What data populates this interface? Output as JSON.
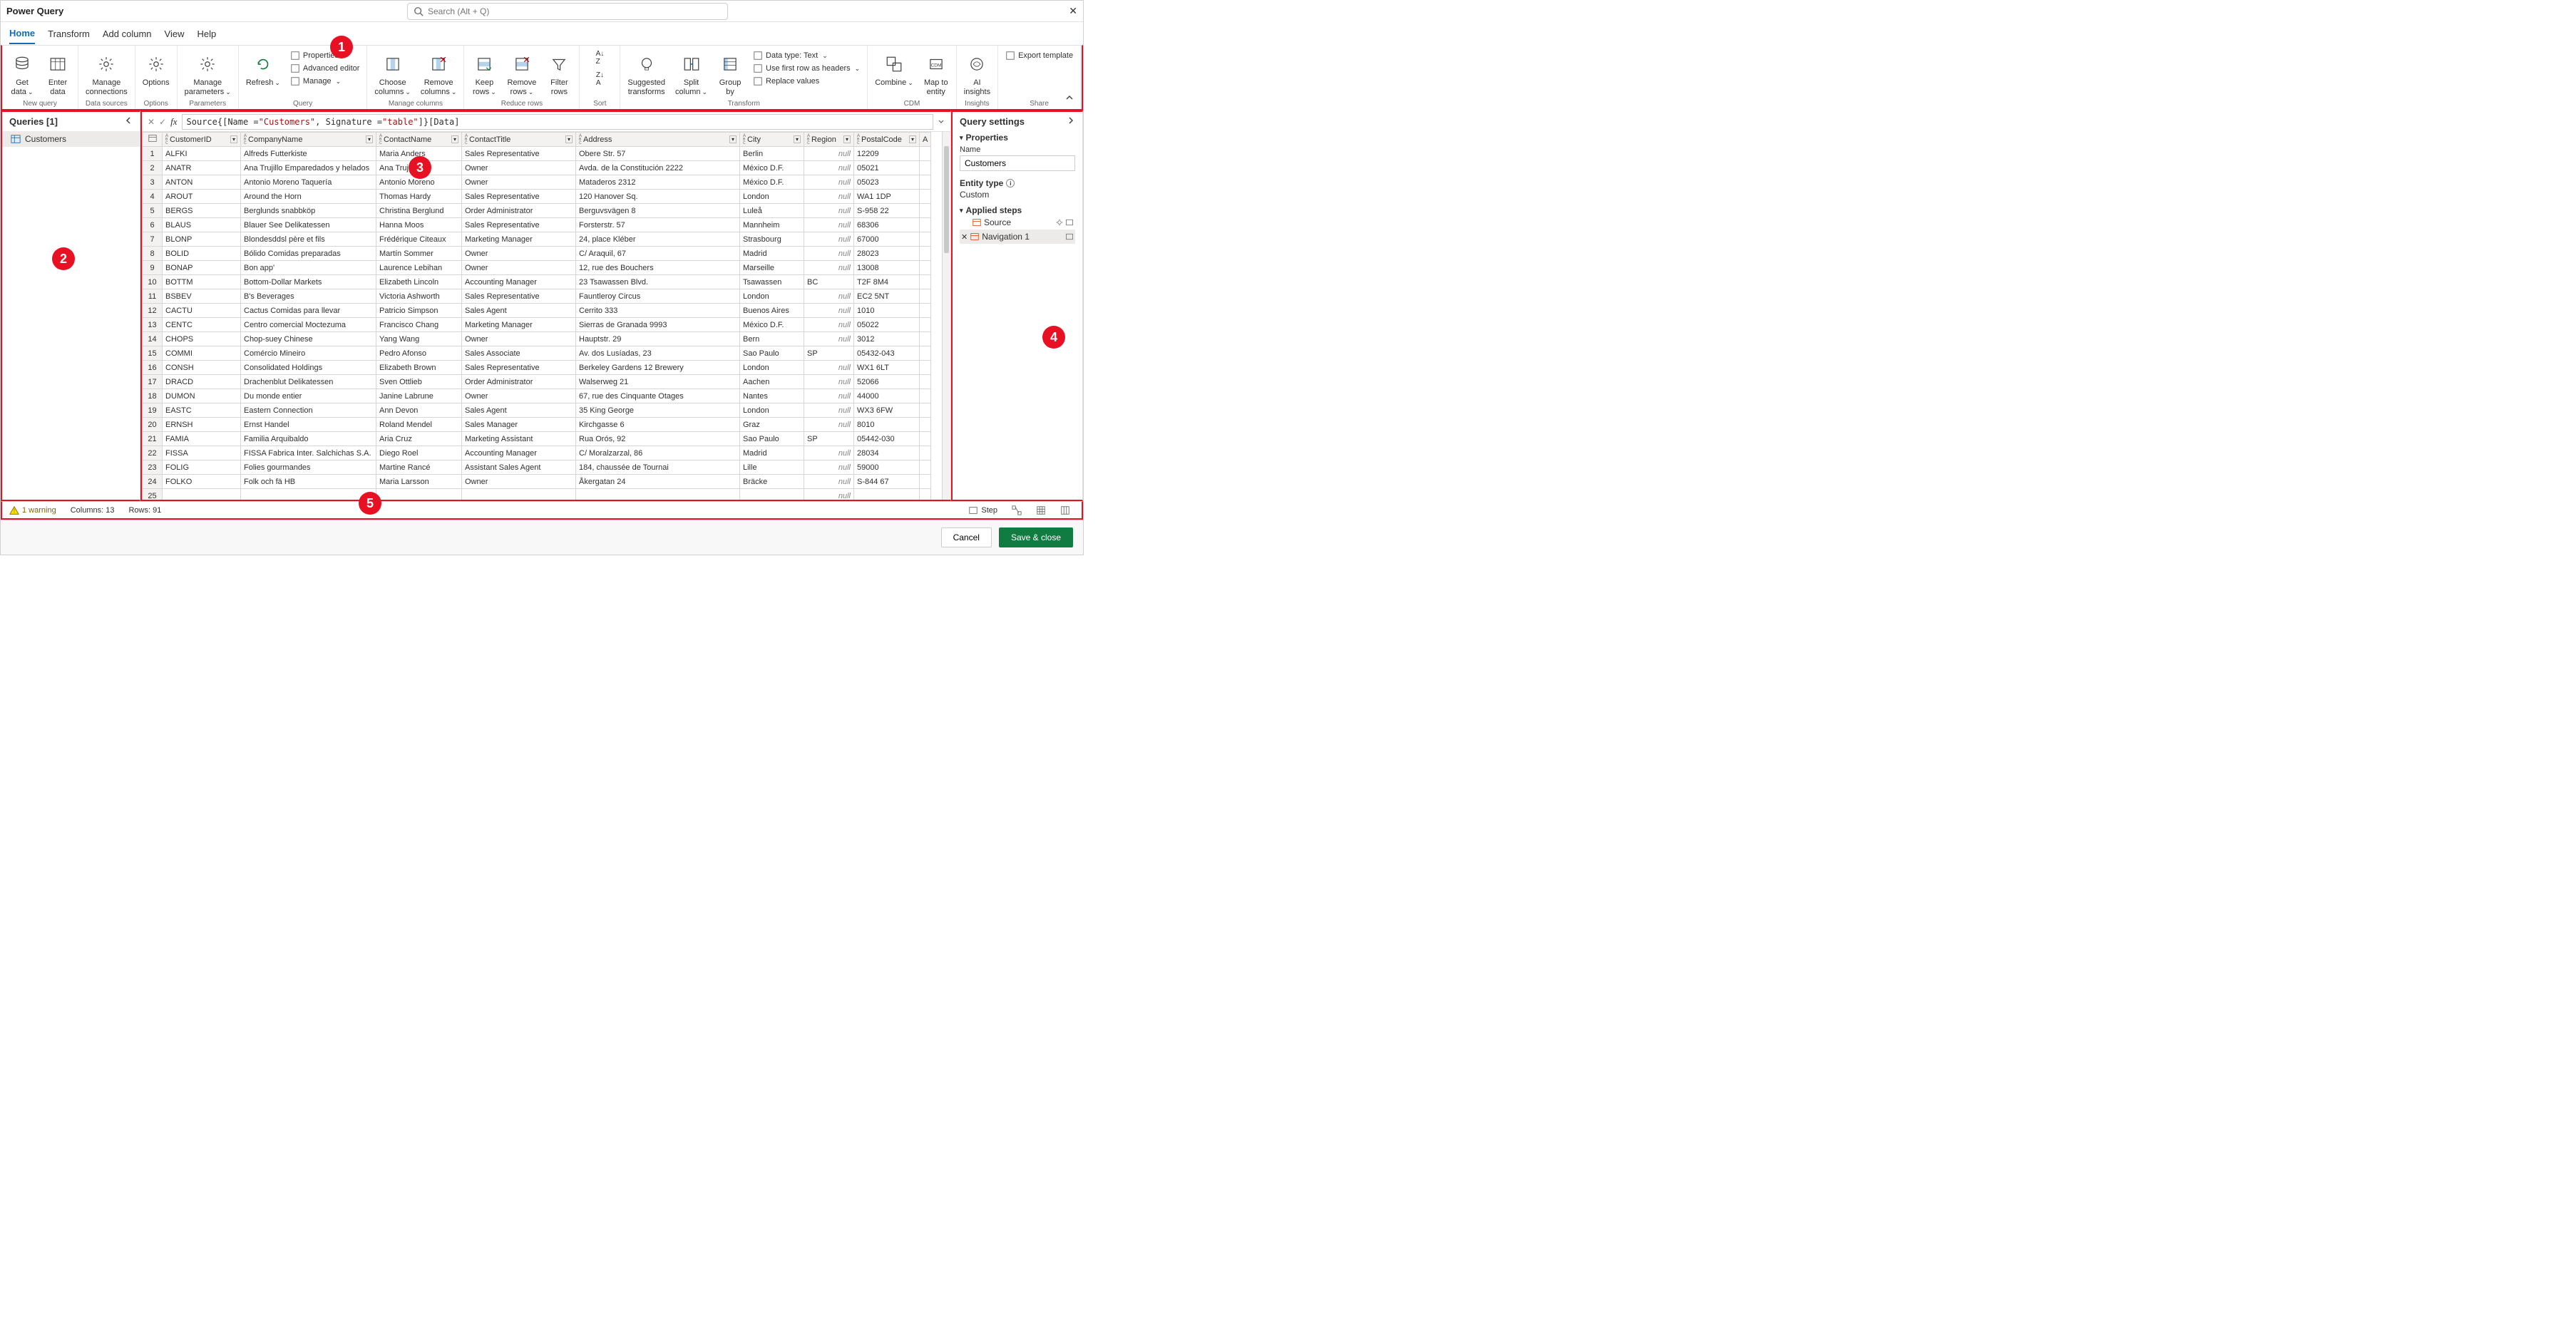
{
  "app_title": "Power Query",
  "search_placeholder": "Search (Alt + Q)",
  "tabs": [
    "Home",
    "Transform",
    "Add column",
    "View",
    "Help"
  ],
  "ribbon": {
    "groups": [
      {
        "label": "New query",
        "buttons": [
          {
            "t": "Get\ndata"
          },
          {
            "t": "Enter\ndata"
          }
        ]
      },
      {
        "label": "Data sources",
        "buttons": [
          {
            "t": "Manage\nconnections"
          }
        ]
      },
      {
        "label": "Options",
        "buttons": [
          {
            "t": "Options"
          }
        ]
      },
      {
        "label": "Parameters",
        "buttons": [
          {
            "t": "Manage\nparameters"
          }
        ]
      },
      {
        "label": "Query",
        "buttons": [
          {
            "t": "Refresh"
          }
        ],
        "lines": [
          "Properties",
          "Advanced editor",
          "Manage"
        ]
      },
      {
        "label": "Manage columns",
        "buttons": [
          {
            "t": "Choose\ncolumns"
          },
          {
            "t": "Remove\ncolumns"
          }
        ]
      },
      {
        "label": "Reduce rows",
        "buttons": [
          {
            "t": "Keep\nrows"
          },
          {
            "t": "Remove\nrows"
          },
          {
            "t": "Filter\nrows"
          }
        ]
      },
      {
        "label": "Sort"
      },
      {
        "label": "Transform",
        "buttons": [
          {
            "t": "Suggested\ntransforms"
          },
          {
            "t": "Split\ncolumn"
          },
          {
            "t": "Group\nby"
          }
        ],
        "lines": [
          "Data type: Text",
          "Use first row as headers",
          "Replace values"
        ]
      },
      {
        "label": "CDM",
        "buttons": [
          {
            "t": "Combine"
          },
          {
            "t": "Map to\nentity"
          }
        ]
      },
      {
        "label": "Insights",
        "buttons": [
          {
            "t": "AI\ninsights"
          }
        ]
      },
      {
        "label": "Share",
        "lines": [
          "Export template"
        ]
      }
    ]
  },
  "queries_header": "Queries [1]",
  "queries": [
    "Customers"
  ],
  "formula": {
    "pre": "Source{[Name = ",
    "q1": "\"Customers\"",
    "mid": ", Signature = ",
    "q2": "\"table\"",
    "post": "]}[Data]"
  },
  "columns": [
    "CustomerID",
    "CompanyName",
    "ContactName",
    "ContactTitle",
    "Address",
    "City",
    "Region",
    "PostalCode"
  ],
  "rows": [
    {
      "n": 1,
      "CustomerID": "ALFKI",
      "CompanyName": "Alfreds Futterkiste",
      "ContactName": "Maria Anders",
      "ContactTitle": "Sales Representative",
      "Address": "Obere Str. 57",
      "City": "Berlin",
      "Region": null,
      "PostalCode": "12209"
    },
    {
      "n": 2,
      "CustomerID": "ANATR",
      "CompanyName": "Ana Trujillo Emparedados y helados",
      "ContactName": "Ana Trujillo",
      "ContactTitle": "Owner",
      "Address": "Avda. de la Constitución 2222",
      "City": "México D.F.",
      "Region": null,
      "PostalCode": "05021"
    },
    {
      "n": 3,
      "CustomerID": "ANTON",
      "CompanyName": "Antonio Moreno Taquería",
      "ContactName": "Antonio Moreno",
      "ContactTitle": "Owner",
      "Address": "Mataderos  2312",
      "City": "México D.F.",
      "Region": null,
      "PostalCode": "05023"
    },
    {
      "n": 4,
      "CustomerID": "AROUT",
      "CompanyName": "Around the Horn",
      "ContactName": "Thomas Hardy",
      "ContactTitle": "Sales Representative",
      "Address": "120 Hanover Sq.",
      "City": "London",
      "Region": null,
      "PostalCode": "WA1 1DP"
    },
    {
      "n": 5,
      "CustomerID": "BERGS",
      "CompanyName": "Berglunds snabbköp",
      "ContactName": "Christina Berglund",
      "ContactTitle": "Order Administrator",
      "Address": "Berguvsvägen  8",
      "City": "Luleå",
      "Region": null,
      "PostalCode": "S-958 22"
    },
    {
      "n": 6,
      "CustomerID": "BLAUS",
      "CompanyName": "Blauer See Delikatessen",
      "ContactName": "Hanna Moos",
      "ContactTitle": "Sales Representative",
      "Address": "Forsterstr. 57",
      "City": "Mannheim",
      "Region": null,
      "PostalCode": "68306"
    },
    {
      "n": 7,
      "CustomerID": "BLONP",
      "CompanyName": "Blondesddsl père et fils",
      "ContactName": "Frédérique Citeaux",
      "ContactTitle": "Marketing Manager",
      "Address": "24, place Kléber",
      "City": "Strasbourg",
      "Region": null,
      "PostalCode": "67000"
    },
    {
      "n": 8,
      "CustomerID": "BOLID",
      "CompanyName": "Bólido Comidas preparadas",
      "ContactName": "Martín Sommer",
      "ContactTitle": "Owner",
      "Address": "C/ Araquil, 67",
      "City": "Madrid",
      "Region": null,
      "PostalCode": "28023"
    },
    {
      "n": 9,
      "CustomerID": "BONAP",
      "CompanyName": "Bon app'",
      "ContactName": "Laurence Lebihan",
      "ContactTitle": "Owner",
      "Address": "12, rue des Bouchers",
      "City": "Marseille",
      "Region": null,
      "PostalCode": "13008"
    },
    {
      "n": 10,
      "CustomerID": "BOTTM",
      "CompanyName": "Bottom-Dollar Markets",
      "ContactName": "Elizabeth Lincoln",
      "ContactTitle": "Accounting Manager",
      "Address": "23 Tsawassen Blvd.",
      "City": "Tsawassen",
      "Region": "BC",
      "PostalCode": "T2F 8M4"
    },
    {
      "n": 11,
      "CustomerID": "BSBEV",
      "CompanyName": "B's Beverages",
      "ContactName": "Victoria Ashworth",
      "ContactTitle": "Sales Representative",
      "Address": "Fauntleroy Circus",
      "City": "London",
      "Region": null,
      "PostalCode": "EC2 5NT"
    },
    {
      "n": 12,
      "CustomerID": "CACTU",
      "CompanyName": "Cactus Comidas para llevar",
      "ContactName": "Patricio Simpson",
      "ContactTitle": "Sales Agent",
      "Address": "Cerrito 333",
      "City": "Buenos Aires",
      "Region": null,
      "PostalCode": "1010"
    },
    {
      "n": 13,
      "CustomerID": "CENTC",
      "CompanyName": "Centro comercial Moctezuma",
      "ContactName": "Francisco Chang",
      "ContactTitle": "Marketing Manager",
      "Address": "Sierras de Granada 9993",
      "City": "México D.F.",
      "Region": null,
      "PostalCode": "05022"
    },
    {
      "n": 14,
      "CustomerID": "CHOPS",
      "CompanyName": "Chop-suey Chinese",
      "ContactName": "Yang Wang",
      "ContactTitle": "Owner",
      "Address": "Hauptstr. 29",
      "City": "Bern",
      "Region": null,
      "PostalCode": "3012"
    },
    {
      "n": 15,
      "CustomerID": "COMMI",
      "CompanyName": "Comércio Mineiro",
      "ContactName": "Pedro Afonso",
      "ContactTitle": "Sales Associate",
      "Address": "Av. dos Lusíadas, 23",
      "City": "Sao Paulo",
      "Region": "SP",
      "PostalCode": "05432-043"
    },
    {
      "n": 16,
      "CustomerID": "CONSH",
      "CompanyName": "Consolidated Holdings",
      "ContactName": "Elizabeth Brown",
      "ContactTitle": "Sales Representative",
      "Address": "Berkeley Gardens 12  Brewery",
      "City": "London",
      "Region": null,
      "PostalCode": "WX1 6LT"
    },
    {
      "n": 17,
      "CustomerID": "DRACD",
      "CompanyName": "Drachenblut Delikatessen",
      "ContactName": "Sven Ottlieb",
      "ContactTitle": "Order Administrator",
      "Address": "Walserweg 21",
      "City": "Aachen",
      "Region": null,
      "PostalCode": "52066"
    },
    {
      "n": 18,
      "CustomerID": "DUMON",
      "CompanyName": "Du monde entier",
      "ContactName": "Janine Labrune",
      "ContactTitle": "Owner",
      "Address": "67, rue des Cinquante Otages",
      "City": "Nantes",
      "Region": null,
      "PostalCode": "44000"
    },
    {
      "n": 19,
      "CustomerID": "EASTC",
      "CompanyName": "Eastern Connection",
      "ContactName": "Ann Devon",
      "ContactTitle": "Sales Agent",
      "Address": "35 King George",
      "City": "London",
      "Region": null,
      "PostalCode": "WX3 6FW"
    },
    {
      "n": 20,
      "CustomerID": "ERNSH",
      "CompanyName": "Ernst Handel",
      "ContactName": "Roland Mendel",
      "ContactTitle": "Sales Manager",
      "Address": "Kirchgasse 6",
      "City": "Graz",
      "Region": null,
      "PostalCode": "8010"
    },
    {
      "n": 21,
      "CustomerID": "FAMIA",
      "CompanyName": "Familia Arquibaldo",
      "ContactName": "Aria Cruz",
      "ContactTitle": "Marketing Assistant",
      "Address": "Rua Orós, 92",
      "City": "Sao Paulo",
      "Region": "SP",
      "PostalCode": "05442-030"
    },
    {
      "n": 22,
      "CustomerID": "FISSA",
      "CompanyName": "FISSA Fabrica Inter. Salchichas S.A.",
      "ContactName": "Diego Roel",
      "ContactTitle": "Accounting Manager",
      "Address": "C/ Moralzarzal, 86",
      "City": "Madrid",
      "Region": null,
      "PostalCode": "28034"
    },
    {
      "n": 23,
      "CustomerID": "FOLIG",
      "CompanyName": "Folies gourmandes",
      "ContactName": "Martine Rancé",
      "ContactTitle": "Assistant Sales Agent",
      "Address": "184, chaussée de Tournai",
      "City": "Lille",
      "Region": null,
      "PostalCode": "59000"
    },
    {
      "n": 24,
      "CustomerID": "FOLKO",
      "CompanyName": "Folk och fä HB",
      "ContactName": "Maria Larsson",
      "ContactTitle": "Owner",
      "Address": "Åkergatan 24",
      "City": "Bräcke",
      "Region": null,
      "PostalCode": "S-844 67"
    },
    {
      "n": 25,
      "CustomerID": "",
      "CompanyName": "",
      "ContactName": "",
      "ContactTitle": "",
      "Address": "",
      "City": "",
      "Region": null,
      "PostalCode": ""
    }
  ],
  "settings": {
    "title": "Query settings",
    "properties": "Properties",
    "name_label": "Name",
    "name_value": "Customers",
    "entity_label": "Entity type",
    "entity_value": "Custom",
    "steps_label": "Applied steps",
    "steps": [
      "Source",
      "Navigation 1"
    ]
  },
  "statusbar": {
    "warning": "1 warning",
    "cols": "Columns: 13",
    "rows": "Rows: 91",
    "step": "Step"
  },
  "footer": {
    "cancel": "Cancel",
    "save": "Save & close"
  }
}
